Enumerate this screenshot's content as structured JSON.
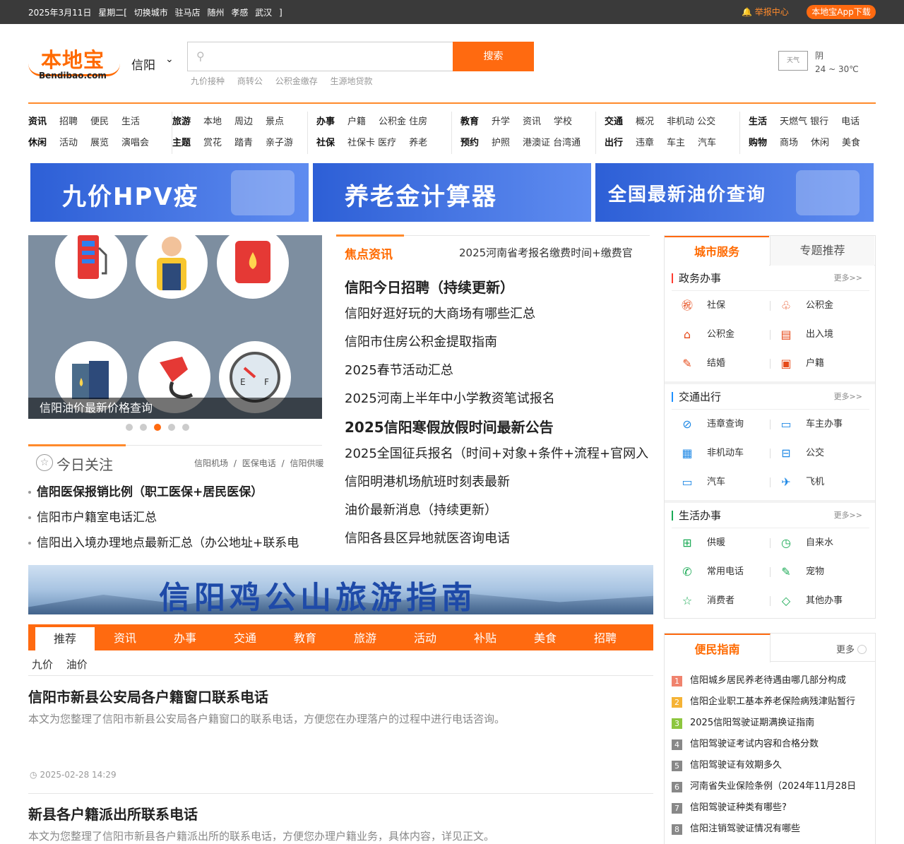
{
  "topbar": {
    "date": "2025年3月11日",
    "weekday": "星期二[",
    "switch_city": "切换城市",
    "cities": [
      "驻马店",
      "随州",
      "孝感",
      "武汉"
    ],
    "close_bracket": "]",
    "report": "举报中心",
    "app": "本地宝App下载"
  },
  "logo": {
    "cn": "本地宝",
    "en": "Bendibao.com"
  },
  "city": "信阳",
  "search": {
    "placeholder": "",
    "button": "搜索",
    "hotwords": [
      "九价接种",
      "商转公",
      "公积金缴存",
      "生源地贷款"
    ]
  },
  "weather": {
    "icon_alt": "天气",
    "condition": "阴",
    "temp": "24 ~ 30℃"
  },
  "nav": [
    {
      "rows": [
        [
          "资讯",
          "招聘",
          "便民",
          "生活"
        ],
        [
          "休闲",
          "活动",
          "展览",
          "演唱会"
        ]
      ]
    },
    {
      "rows": [
        [
          "旅游",
          "本地",
          "周边",
          "景点"
        ],
        [
          "主题",
          "赏花",
          "踏青",
          "亲子游"
        ]
      ]
    },
    {
      "rows": [
        [
          "办事",
          "户籍",
          "公积金 住房"
        ],
        [
          "社保",
          "社保卡 医疗",
          "养老"
        ]
      ]
    },
    {
      "rows": [
        [
          "教育",
          "升学",
          "资讯",
          "学校"
        ],
        [
          "预约",
          "护照",
          "港澳证 台湾通"
        ]
      ]
    },
    {
      "rows": [
        [
          "交通",
          "概况",
          "非机动 公交"
        ],
        [
          "出行",
          "违章",
          "车主",
          "汽车"
        ]
      ]
    },
    {
      "rows": [
        [
          "生活",
          "天燃气 银行",
          "电话"
        ],
        [
          "购物",
          "商场",
          "休闲",
          "美食"
        ]
      ]
    }
  ],
  "banners": [
    "九价HPV疫",
    "养老金计算器",
    "全国最新油价查询"
  ],
  "slider": {
    "caption": "信阳油价最新价格查询",
    "active": 3,
    "count": 5
  },
  "today": {
    "title": "今日关注",
    "links": [
      "信阳机场",
      "/",
      "医保电话",
      "/",
      "信阳供暖"
    ],
    "items": [
      "信阳医保报销比例（职工医保+居民医保）",
      "信阳市户籍室电话汇总",
      "信阳出入境办理地点最新汇总（办公地址+联系电"
    ]
  },
  "focus": {
    "title": "焦点资讯",
    "marquee": "2025河南省考报名缴费时间+缴费官",
    "items": [
      {
        "text": "信阳今日招聘（持续更新）",
        "big": true
      },
      {
        "text": "信阳好逛好玩的大商场有哪些汇总",
        "big": false
      },
      {
        "text": "信阳市住房公积金提取指南",
        "big": false
      },
      {
        "text": "2025春节活动汇总",
        "big": false
      },
      {
        "text": "2025河南上半年中小学教资笔试报名",
        "big": false
      },
      {
        "text": "2025信阳寒假放假时间最新公告",
        "big": true
      },
      {
        "text": "2025全国征兵报名（时间+对象+条件+流程+官网入",
        "big": false
      },
      {
        "text": "信阳明港机场航班时刻表最新",
        "big": false
      },
      {
        "text": "油价最新消息（持续更新）",
        "big": false
      },
      {
        "text": "信阳各县区异地就医咨询电话",
        "big": false
      }
    ]
  },
  "jgs_banner": "信阳鸡公山旅游指南",
  "tabs": [
    "推荐",
    "资讯",
    "办事",
    "交通",
    "教育",
    "旅游",
    "活动",
    "补贴",
    "美食",
    "招聘"
  ],
  "subtabs": [
    "九价",
    "油价"
  ],
  "articles": [
    {
      "title": "信阳市新县公安局各户籍窗口联系电话",
      "desc": "本文为您整理了信阳市新县公安局各户籍窗口的联系电话，方便您在办理落户的过程中进行电话咨询。",
      "time": "2025-02-28 14:29"
    },
    {
      "title": "新县各户籍派出所联系电话",
      "desc": "本文为您整理了信阳市新县各户籍派出所的联系电话，方便您办理户籍业务，具体内容，详见正文。"
    }
  ],
  "service": {
    "tabs": [
      "城市服务",
      "专题推荐"
    ],
    "sections": [
      {
        "title": "政务办事",
        "more": "更多>>",
        "items": [
          [
            "社保",
            "公积金"
          ],
          [
            "公积金",
            "出入境"
          ],
          [
            "结婚",
            "户籍"
          ]
        ]
      },
      {
        "title": "交通出行",
        "more": "更多>>",
        "items": [
          [
            "违章查询",
            "车主办事"
          ],
          [
            "非机动车",
            "公交"
          ],
          [
            "汽车",
            "飞机"
          ]
        ]
      },
      {
        "title": "生活办事",
        "more": "更多>>",
        "items": [
          [
            "供暖",
            "自来水"
          ],
          [
            "常用电话",
            "宠物"
          ],
          [
            "消费者",
            "其他办事"
          ]
        ]
      }
    ]
  },
  "guide": {
    "title": "便民指南",
    "more": "更多",
    "items": [
      {
        "n": "1",
        "color": "#f0836e",
        "text": "信阳城乡居民养老待遇由哪几部分构成"
      },
      {
        "n": "2",
        "color": "#f5b335",
        "text": "信阳企业职工基本养老保险病残津贴暂行"
      },
      {
        "n": "3",
        "color": "#8dc63f",
        "text": "2025信阳驾驶证期满换证指南"
      },
      {
        "n": "4",
        "color": "#888888",
        "text": "信阳驾驶证考试内容和合格分数"
      },
      {
        "n": "5",
        "color": "#888888",
        "text": "信阳驾驶证有效期多久"
      },
      {
        "n": "6",
        "color": "#888888",
        "text": "河南省失业保险条例（2024年11月28日"
      },
      {
        "n": "7",
        "color": "#888888",
        "text": "信阳驾驶证种类有哪些?"
      },
      {
        "n": "8",
        "color": "#888888",
        "text": "信阳注销驾驶证情况有哪些"
      }
    ]
  }
}
